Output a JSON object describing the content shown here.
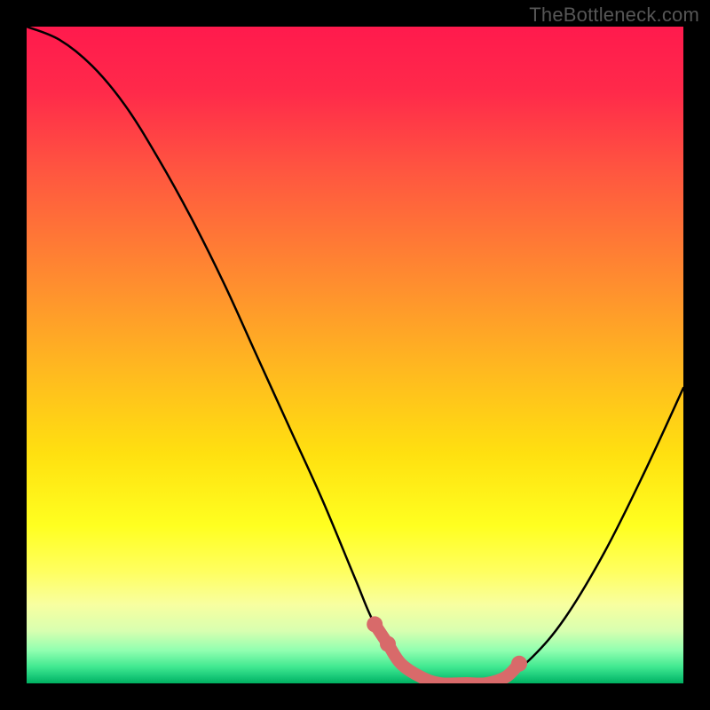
{
  "watermark": "TheBottleneck.com",
  "colors": {
    "frame_bg": "#000000",
    "curve_stroke": "#000000",
    "highlight_stroke": "#d86a6a",
    "gradient_top": "#ff1a4d",
    "gradient_bottom": "#00b060"
  },
  "chart_data": {
    "type": "line",
    "title": "",
    "xlabel": "",
    "ylabel": "",
    "xlim": [
      0,
      100
    ],
    "ylim": [
      0,
      100
    ],
    "grid": false,
    "legend": false,
    "series": [
      {
        "name": "bottleneck-curve",
        "x": [
          0,
          5,
          10,
          15,
          20,
          25,
          30,
          35,
          40,
          45,
          50,
          53,
          57,
          60,
          63,
          67,
          70,
          73,
          77,
          82,
          88,
          94,
          100
        ],
        "y": [
          100,
          98,
          94,
          88,
          80,
          71,
          61,
          50,
          39,
          28,
          16,
          9,
          3,
          1,
          0,
          0,
          0,
          1,
          4,
          10,
          20,
          32,
          45
        ]
      },
      {
        "name": "optimal-zone-highlight",
        "x": [
          53,
          55,
          57,
          60,
          63,
          67,
          70,
          73,
          75
        ],
        "y": [
          9,
          6,
          3,
          1,
          0,
          0,
          0,
          1,
          3
        ]
      }
    ],
    "highlight_dots": [
      {
        "x": 53,
        "y": 9
      },
      {
        "x": 55,
        "y": 6
      },
      {
        "x": 75,
        "y": 3
      }
    ],
    "annotations": []
  }
}
